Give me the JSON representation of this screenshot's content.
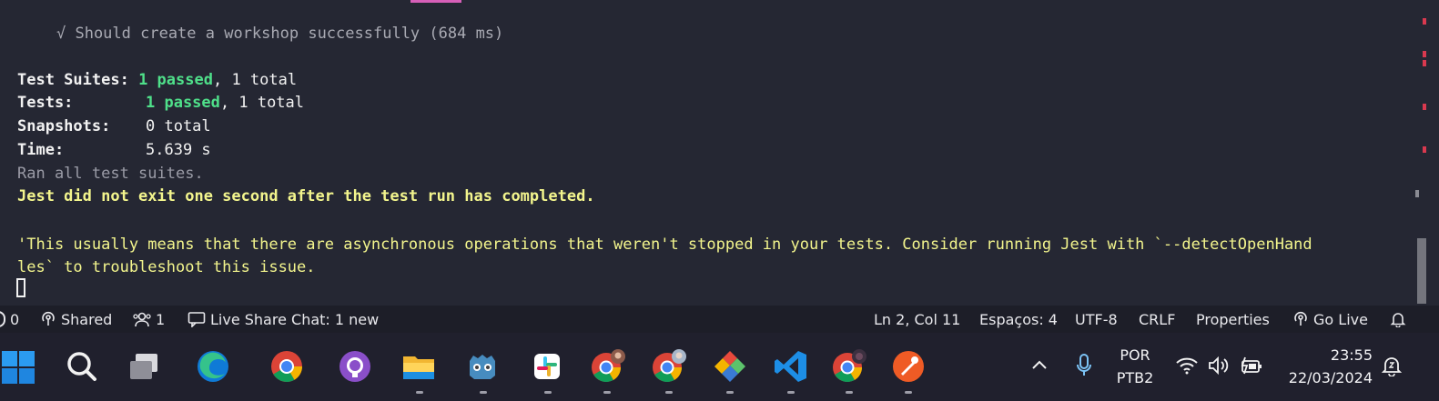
{
  "terminal": {
    "test_case": "√ Should create a workshop successfully (684 ms)",
    "summary": {
      "suites_label": "Test Suites:",
      "suites_passed": "1 passed",
      "suites_total": ", 1 total",
      "tests_label": "Tests:",
      "tests_passed": "1 passed",
      "tests_total": ", 1 total",
      "snapshots_label": "Snapshots:",
      "snapshots_value": "0 total",
      "time_label": "Time:",
      "time_value": "5.639 s"
    },
    "ran_all": "Ran all test suites.",
    "warning": "Jest did not exit one second after the test run has completed.",
    "message_line1": "'This usually means that there are asynchronous operations that weren't stopped in your tests. Consider running Jest with `--detectOpenHand",
    "message_line2": "les` to troubleshoot this issue."
  },
  "statusbar": {
    "problems_count": "0",
    "shared": "Shared",
    "participants": "1",
    "live_share_chat": "Live Share Chat: 1 new",
    "cursor_position": "Ln 2, Col 11",
    "indentation": "Espaços: 4",
    "encoding": "UTF-8",
    "line_ending": "CRLF",
    "language": "Properties",
    "go_live": "Go Live"
  },
  "taskbar": {
    "apps": [
      {
        "name": "windows-start-icon"
      },
      {
        "name": "search-icon"
      },
      {
        "name": "task-view-icon"
      },
      {
        "name": "edge-icon"
      },
      {
        "name": "chrome-icon"
      },
      {
        "name": "github-desktop-icon"
      },
      {
        "name": "file-explorer-icon"
      },
      {
        "name": "godot-icon"
      },
      {
        "name": "slack-icon"
      },
      {
        "name": "chrome-profile-icon"
      },
      {
        "name": "chrome-profile-icon"
      },
      {
        "name": "gitkraken-icon"
      },
      {
        "name": "vscode-icon"
      },
      {
        "name": "chrome-profile-icon"
      },
      {
        "name": "postman-icon"
      }
    ],
    "language_top": "POR",
    "language_bottom": "PTB2",
    "time": "23:55",
    "date": "22/03/2024"
  },
  "colors": {
    "terminal_bg": "#252733",
    "passed_green": "#4fe08a",
    "warning_yellow": "#f3f58d",
    "statusbar_bg": "#1d1e28",
    "taskbar_bg": "#20202d"
  }
}
